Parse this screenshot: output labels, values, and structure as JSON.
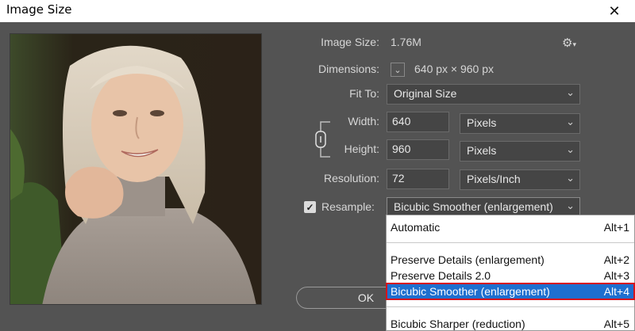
{
  "window": {
    "title": "Image Size",
    "close_glyph": "✕"
  },
  "info": {
    "image_size_label": "Image Size:",
    "image_size_value": "1.76M",
    "dimensions_label": "Dimensions:",
    "dimensions_value": "640 px  ×  960 px"
  },
  "fit_to": {
    "label": "Fit To:",
    "value": "Original Size"
  },
  "width": {
    "label": "Width:",
    "value": "640",
    "unit": "Pixels"
  },
  "height": {
    "label": "Height:",
    "value": "960",
    "unit": "Pixels"
  },
  "resolution": {
    "label": "Resolution:",
    "value": "72",
    "unit": "Pixels/Inch"
  },
  "resample": {
    "label": "Resample:",
    "checked": true,
    "value": "Bicubic Smoother (enlargement)"
  },
  "buttons": {
    "ok": "OK"
  },
  "menu": {
    "items": [
      {
        "label": "Automatic",
        "shortcut": "Alt+1"
      },
      {
        "label": "Preserve Details (enlargement)",
        "shortcut": "Alt+2"
      },
      {
        "label": "Preserve Details 2.0",
        "shortcut": "Alt+3"
      },
      {
        "label": "Bicubic Smoother (enlargement)",
        "shortcut": "Alt+4"
      },
      {
        "label": "Bicubic Sharper (reduction)",
        "shortcut": "Alt+5"
      }
    ]
  },
  "icons": {
    "chevron": "⌄",
    "check": "✓",
    "gear": "⚙"
  }
}
